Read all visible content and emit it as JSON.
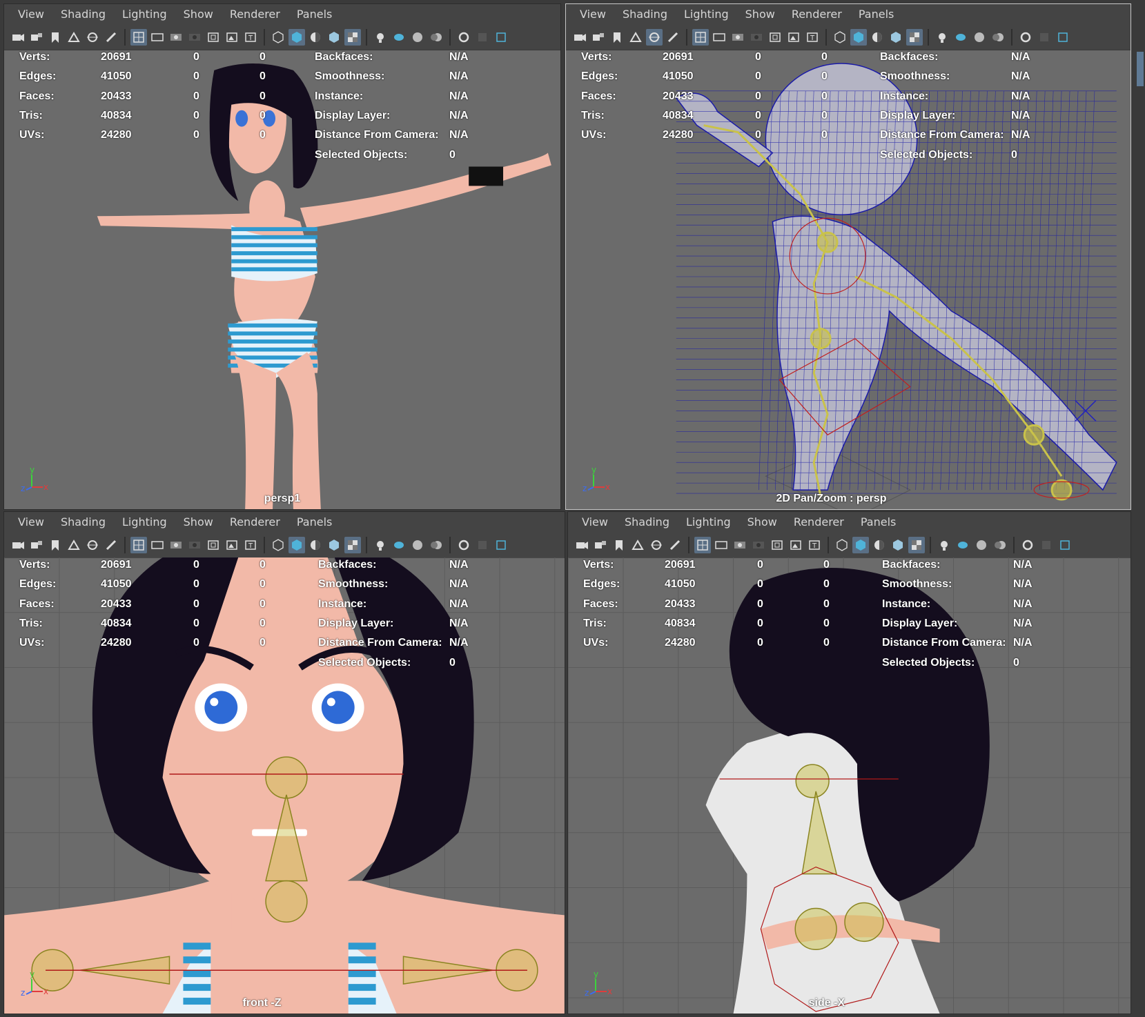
{
  "menu": [
    "View",
    "Shading",
    "Lighting",
    "Show",
    "Renderer",
    "Panels"
  ],
  "toolbar_icons": [
    "camera-icon",
    "camera-attrs-icon",
    "bookmark-icon",
    "image-plane-icon",
    "2d-pan-zoom-icon",
    "grease-pencil-icon",
    "grid-icon",
    "film-gate-icon",
    "resolution-gate-icon",
    "gate-mask-icon",
    "field-chart-icon",
    "safe-action-icon",
    "safe-title-icon",
    "wireframe-icon",
    "smooth-shade-icon",
    "wireframe-on-shaded-icon",
    "default-material-icon",
    "textured-icon",
    "use-all-lights-icon",
    "shadows-icon",
    "ambient-occlusion-icon",
    "motion-blur-icon",
    "anti-aliasing-icon",
    "depth-of-field-icon",
    "isolate-select-icon"
  ],
  "hud": {
    "labels": [
      "Verts:",
      "Edges:",
      "Faces:",
      "Tris:",
      "UVs:"
    ],
    "values": [
      "20691",
      "41050",
      "20433",
      "40834",
      "24280"
    ],
    "sel1": [
      "0",
      "0",
      "0",
      "0",
      "0"
    ],
    "sel2": [
      "0",
      "0",
      "0",
      "0",
      "0"
    ],
    "right_labels": [
      "Backfaces:",
      "Smoothness:",
      "Instance:",
      "Display Layer:",
      "Distance From Camera:",
      "Selected Objects:"
    ],
    "right_values": [
      "N/A",
      "N/A",
      "N/A",
      "N/A",
      "N/A",
      "0"
    ]
  },
  "panes": [
    {
      "camera": "persp1"
    },
    {
      "camera": "2D Pan/Zoom : persp"
    },
    {
      "camera": "front -Z"
    },
    {
      "camera": "side -X"
    }
  ],
  "axis": {
    "x": "x",
    "y": "y",
    "z": "z"
  },
  "colors": {
    "skin": "#f2b9a8",
    "hair": "#140d1e",
    "stripe": "#2d9ad0",
    "joint": "#c9c24a",
    "wire": "#1a1aa8",
    "viewport": "#6b6b6b",
    "active": "#5a6f85"
  }
}
